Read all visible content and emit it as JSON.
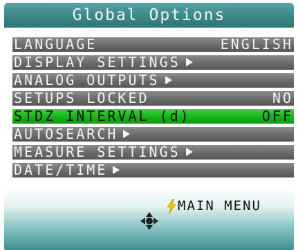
{
  "screen": {
    "title": "Global Options",
    "accent_title_color": "#3f8c8c",
    "selected_color": "#16b416"
  },
  "menu": {
    "items": [
      {
        "label": "LANGUAGE",
        "value": "ENGLISH",
        "submenu": false,
        "selected": false
      },
      {
        "label": "DISPLAY SETTINGS",
        "value": "",
        "submenu": true,
        "selected": false
      },
      {
        "label": "ANALOG OUTPUTS",
        "value": "",
        "submenu": true,
        "selected": false
      },
      {
        "label": "SETUPS LOCKED",
        "value": "NO",
        "submenu": false,
        "selected": false
      },
      {
        "label": "STDZ INTERVAL (d)",
        "value": "OFF",
        "submenu": false,
        "selected": true
      },
      {
        "label": "AUTOSEARCH",
        "value": "",
        "submenu": true,
        "selected": false
      },
      {
        "label": "MEASURE SETTINGS",
        "value": "",
        "submenu": true,
        "selected": false
      },
      {
        "label": "DATE/TIME",
        "value": "",
        "submenu": true,
        "selected": false
      }
    ]
  },
  "footer": {
    "main_menu_label": "MAIN MENU",
    "main_menu_icon": "lightning-bolt-icon",
    "nav_icon": "four-way-arrow-icon"
  }
}
